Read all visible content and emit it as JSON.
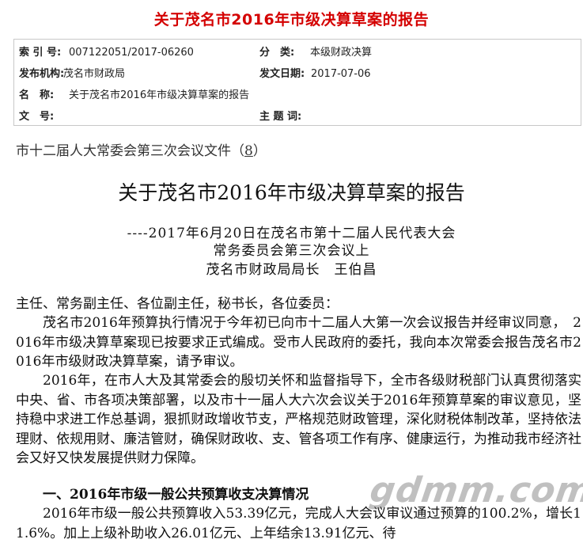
{
  "header": {
    "title": "关于茂名市2016年市级决算草案的报告"
  },
  "meta": {
    "index_label": "索 引 号:",
    "index_value": "007122051/2017-06260",
    "category_label": "分　类:",
    "category_value": "本级财政决算",
    "publisher_label": "发布机构:",
    "publisher_value": "茂名市财政局",
    "date_label": "发文日期:",
    "date_value": "2017-07-06",
    "name_label": "名　称:",
    "name_value": "关于茂名市2016年市级决算草案的报告",
    "docno_label": "文　号:",
    "docno_value": "",
    "subject_label": "主 题 词:",
    "subject_value": ""
  },
  "document": {
    "session_prefix": "市十二届人大常委会第三次会议文件（",
    "session_number": "8",
    "session_suffix": "）",
    "title": "关于茂名市2016年市级决算草案的报告",
    "byline1": "----2017年6月20日在茂名市第十二届人民代表大会",
    "byline2": "常务委员会第三次会议上",
    "byline3": "茂名市财政局局长　王伯昌",
    "salutation": "主任、常务副主任、各位副主任，秘书长，各位委员：",
    "para1": "茂名市2016年预算执行情况于今年初已向市十二届人大第一次会议报告并经审议同意，　2016年市级决算草案现已按要求正式编成。受市人民政府的委托，我向本次常委会报告茂名市2016年市级财政决算草案，请予审议。",
    "para2": "2016年，在市人大及其常委会的殷切关怀和监督指导下，全市各级财税部门认真贯彻落实中央、省、市各项决策部署，以及市十一届人大六次会议关于2016年预算草案的审议意见，坚持稳中求进工作总基调，狠抓财政增收节支，严格规范财政管理，深化财税体制改革，坚持依法理财、依规用财、廉洁管财，确保财政收、支、管各项工作有序、健康运行，为推动我市经济社会又好又快发展提供财力保障。",
    "section1": "一、2016年市级一般公共预算收支决算情况",
    "para3": "2016年市级一般公共预算收入53.39亿元，完成人大会议审议通过预算的100.2%，增长11.6%。加上上级补助收入26.01亿元、上年结余13.91亿元、待"
  },
  "watermark": "gdmm.com"
}
